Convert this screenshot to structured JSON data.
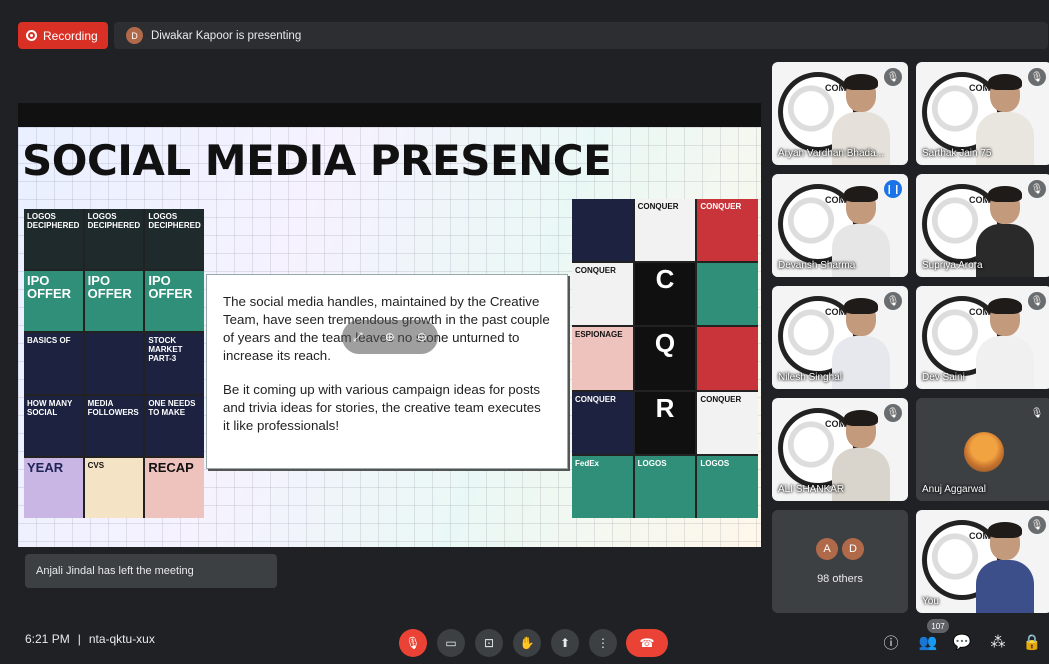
{
  "recording": {
    "label": "Recording"
  },
  "presenter_bar": {
    "avatar_letter": "D",
    "text": "Diwakar Kapoor is presenting"
  },
  "slide": {
    "title": "SOCIAL MEDIA PRESENCE",
    "paragraph1": "The social media handles, maintained by the Creative Team, have seen tremendous growth in the past couple of years and the team leaves no stone unturned to increase its reach.",
    "paragraph2": "Be it coming up with various campaign ideas for posts and trivia ideas for stories, the creative team executes it like professionals!",
    "left_tiles": [
      {
        "style": "t-dark",
        "text": "LOGOS DECIPHERED"
      },
      {
        "style": "t-dark",
        "text": "LOGOS DECIPHERED"
      },
      {
        "style": "t-dark",
        "text": "LOGOS DECIPHERED"
      },
      {
        "style": "t-teal",
        "text": "IPO OFFER"
      },
      {
        "style": "t-teal",
        "text": "IPO OFFER"
      },
      {
        "style": "t-teal",
        "text": "IPO OFFER"
      },
      {
        "style": "t-navy",
        "text": "BASICS OF"
      },
      {
        "style": "t-navy",
        "text": ""
      },
      {
        "style": "t-navy",
        "text": "STOCK MARKET PART-3"
      },
      {
        "style": "t-navy",
        "text": "HOW MANY SOCIAL"
      },
      {
        "style": "t-navy",
        "text": "MEDIA FOLLOWERS"
      },
      {
        "style": "t-navy",
        "text": "ONE NEEDS TO MAKE"
      },
      {
        "style": "t-lav",
        "text": "YEAR"
      },
      {
        "style": "t-cream",
        "text": "CVS"
      },
      {
        "style": "t-pink",
        "text": "RECAP"
      }
    ],
    "right_tiles": [
      {
        "style": "t-navy",
        "text": ""
      },
      {
        "style": "t-white",
        "text": "CONQUER"
      },
      {
        "style": "t-red",
        "text": "CONQUER"
      },
      {
        "style": "t-white",
        "text": "CONQUER"
      },
      {
        "style": "t-black",
        "text": "C"
      },
      {
        "style": "t-teal",
        "text": ""
      },
      {
        "style": "t-pink",
        "text": "ESPIONAGE"
      },
      {
        "style": "t-black",
        "text": "Q"
      },
      {
        "style": "t-red",
        "text": ""
      },
      {
        "style": "t-navy",
        "text": "CONQUER"
      },
      {
        "style": "t-black",
        "text": "R"
      },
      {
        "style": "t-white",
        "text": "CONQUER"
      },
      {
        "style": "t-teal",
        "text": "FedEx"
      },
      {
        "style": "t-teal",
        "text": "LOGOS"
      },
      {
        "style": "t-teal",
        "text": "LOGOS"
      }
    ]
  },
  "toast": {
    "text": "Anjali Jindal has left the meeting"
  },
  "participants": [
    {
      "name": "Aryan Vardhan Bhada...",
      "status": "muted"
    },
    {
      "name": "Sarthak Jain 75",
      "status": "muted"
    },
    {
      "name": "Devansh Sharma",
      "status": "speaking"
    },
    {
      "name": "Supriya Arora",
      "status": "muted"
    },
    {
      "name": "Nilesh Singhal",
      "status": "muted"
    },
    {
      "name": "Dev Saini",
      "status": "muted"
    },
    {
      "name": "ALI SHANKAR",
      "status": "muted"
    },
    {
      "name": "Anuj Aggarwal",
      "status": "muted"
    }
  ],
  "others": {
    "avatars": [
      "A",
      "D"
    ],
    "label": "98 others"
  },
  "self_tile": {
    "name": "You"
  },
  "bottom_bar": {
    "time": "6:21 PM",
    "separator": "|",
    "meeting_code": "nta-qktu-xux",
    "participant_count": "107"
  },
  "colors": {
    "end_call": "#ea4335",
    "recording": "#d93025",
    "speaking": "#1a73e8",
    "background": "#202124"
  }
}
